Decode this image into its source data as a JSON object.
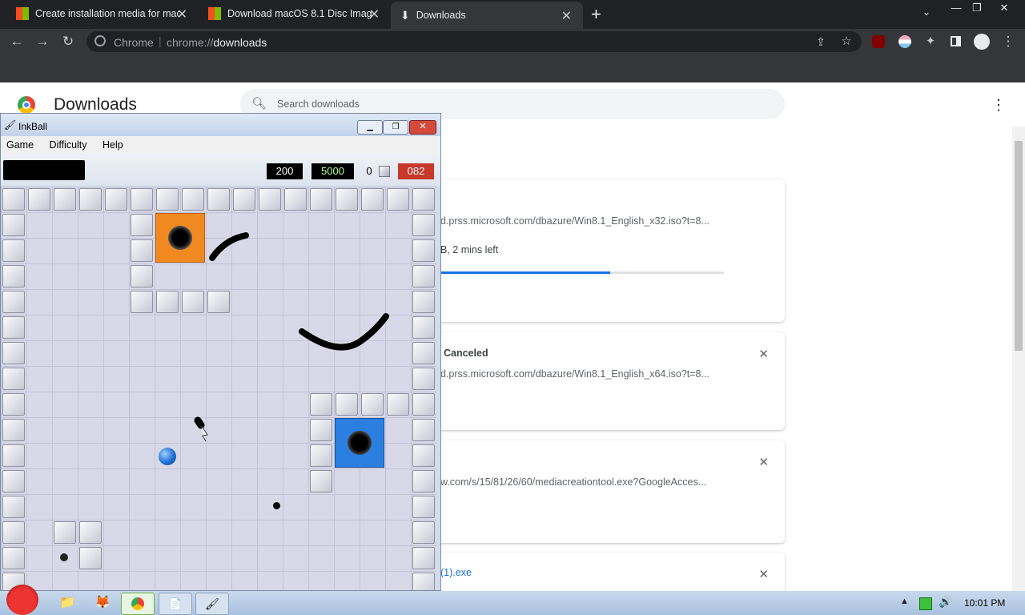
{
  "browser": {
    "tabs": [
      {
        "label": "Create installation media for mac"
      },
      {
        "label": "Download macOS 8.1 Disc Image"
      },
      {
        "label": "Downloads"
      }
    ],
    "omnibox": {
      "site_label": "Chrome",
      "url_prefix": "chrome://",
      "url_path": "downloads"
    }
  },
  "downloads_page": {
    "title": "Downloads",
    "search_placeholder": "Search downloads",
    "items": [
      {
        "url": "d.prss.microsoft.com/dbazure/Win8.1_English_x32.iso?t=8...",
        "status": "B, 2 mins left",
        "progress": 0.6
      },
      {
        "title": "Canceled",
        "url": "d.prss.microsoft.com/dbazure/Win8.1_English_x64.iso?t=8..."
      },
      {
        "url": "w.com/s/15/81/26/60/mediacreationtool.exe?GoogleAcces..."
      },
      {
        "title": "(1).exe"
      }
    ]
  },
  "inkball": {
    "title": "InkBall",
    "menu": [
      "Game",
      "Difficulty",
      "Help"
    ],
    "score": "200",
    "bonus": "5000",
    "lives": "0",
    "timer": "082",
    "colors": {
      "orange_hole": "#f08a20",
      "blue_hole": "#2b7fe0",
      "blue_ball": "#1f6fd6"
    }
  },
  "taskbar": {
    "clock": "10:01 PM"
  },
  "icons": [
    "back-icon",
    "forward-icon",
    "reload-icon",
    "chrome-logo-icon",
    "share-icon",
    "star-icon",
    "extensions-icon",
    "side-panel-icon",
    "profile-icon",
    "more-vert-icon",
    "search-icon",
    "close-icon"
  ]
}
